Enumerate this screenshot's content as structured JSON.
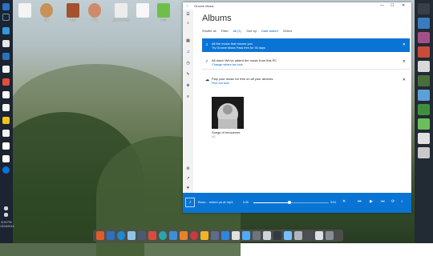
{
  "desktop": {
    "icons": [
      {
        "label": ""
      },
      {
        "label": "Bill"
      },
      {
        "label": "Bob"
      },
      {
        "label": "Ann"
      },
      {
        "label": "Blog Comments"
      },
      {
        "label": ""
      },
      {
        "label": "MP3"
      }
    ]
  },
  "left_taskbar": {
    "time": "8:15 PM",
    "date": "10/16/2016"
  },
  "window": {
    "title": "Groove Music",
    "back": "←",
    "minimize": "—",
    "maximize": "☐",
    "close": "✕"
  },
  "rail": [
    "☰",
    "⌕",
    "▦",
    "♫",
    "◷",
    "✎",
    "⊕",
    "≡",
    "⚙",
    "↗",
    "♥"
  ],
  "page": {
    "title": "Albums",
    "shuffle": "Shuffle all",
    "filter_label": "Filter:",
    "filter_value": "All (1)",
    "sort_label": "Sort by:",
    "sort_value": "Date added",
    "select": "Select"
  },
  "notifications": [
    {
      "icon": "♫",
      "line1": "All the music that moves you",
      "line2": "Try Groove Music Pass free for 30 days",
      "close": "✕"
    },
    {
      "icon": "✓",
      "line1": "All done! We've added the music from this PC",
      "line2": "Change where we look",
      "close": "✕"
    },
    {
      "icon": "☁",
      "line1": "Play your music for free on all your devices.",
      "line2": "Find out how",
      "close": "✕"
    }
  ],
  "album": {
    "name": "Songs of Innocence",
    "artist": "U2"
  },
  "player": {
    "now_playing": "Bono... where ya at mp3",
    "elapsed": "0:45",
    "total": "3:34",
    "progress": 0.48,
    "shuffle": "✕",
    "prev": "⏮",
    "play": "▶",
    "next": "⏭",
    "repeat": "⟳",
    "volume": "♪",
    "more": "…"
  }
}
